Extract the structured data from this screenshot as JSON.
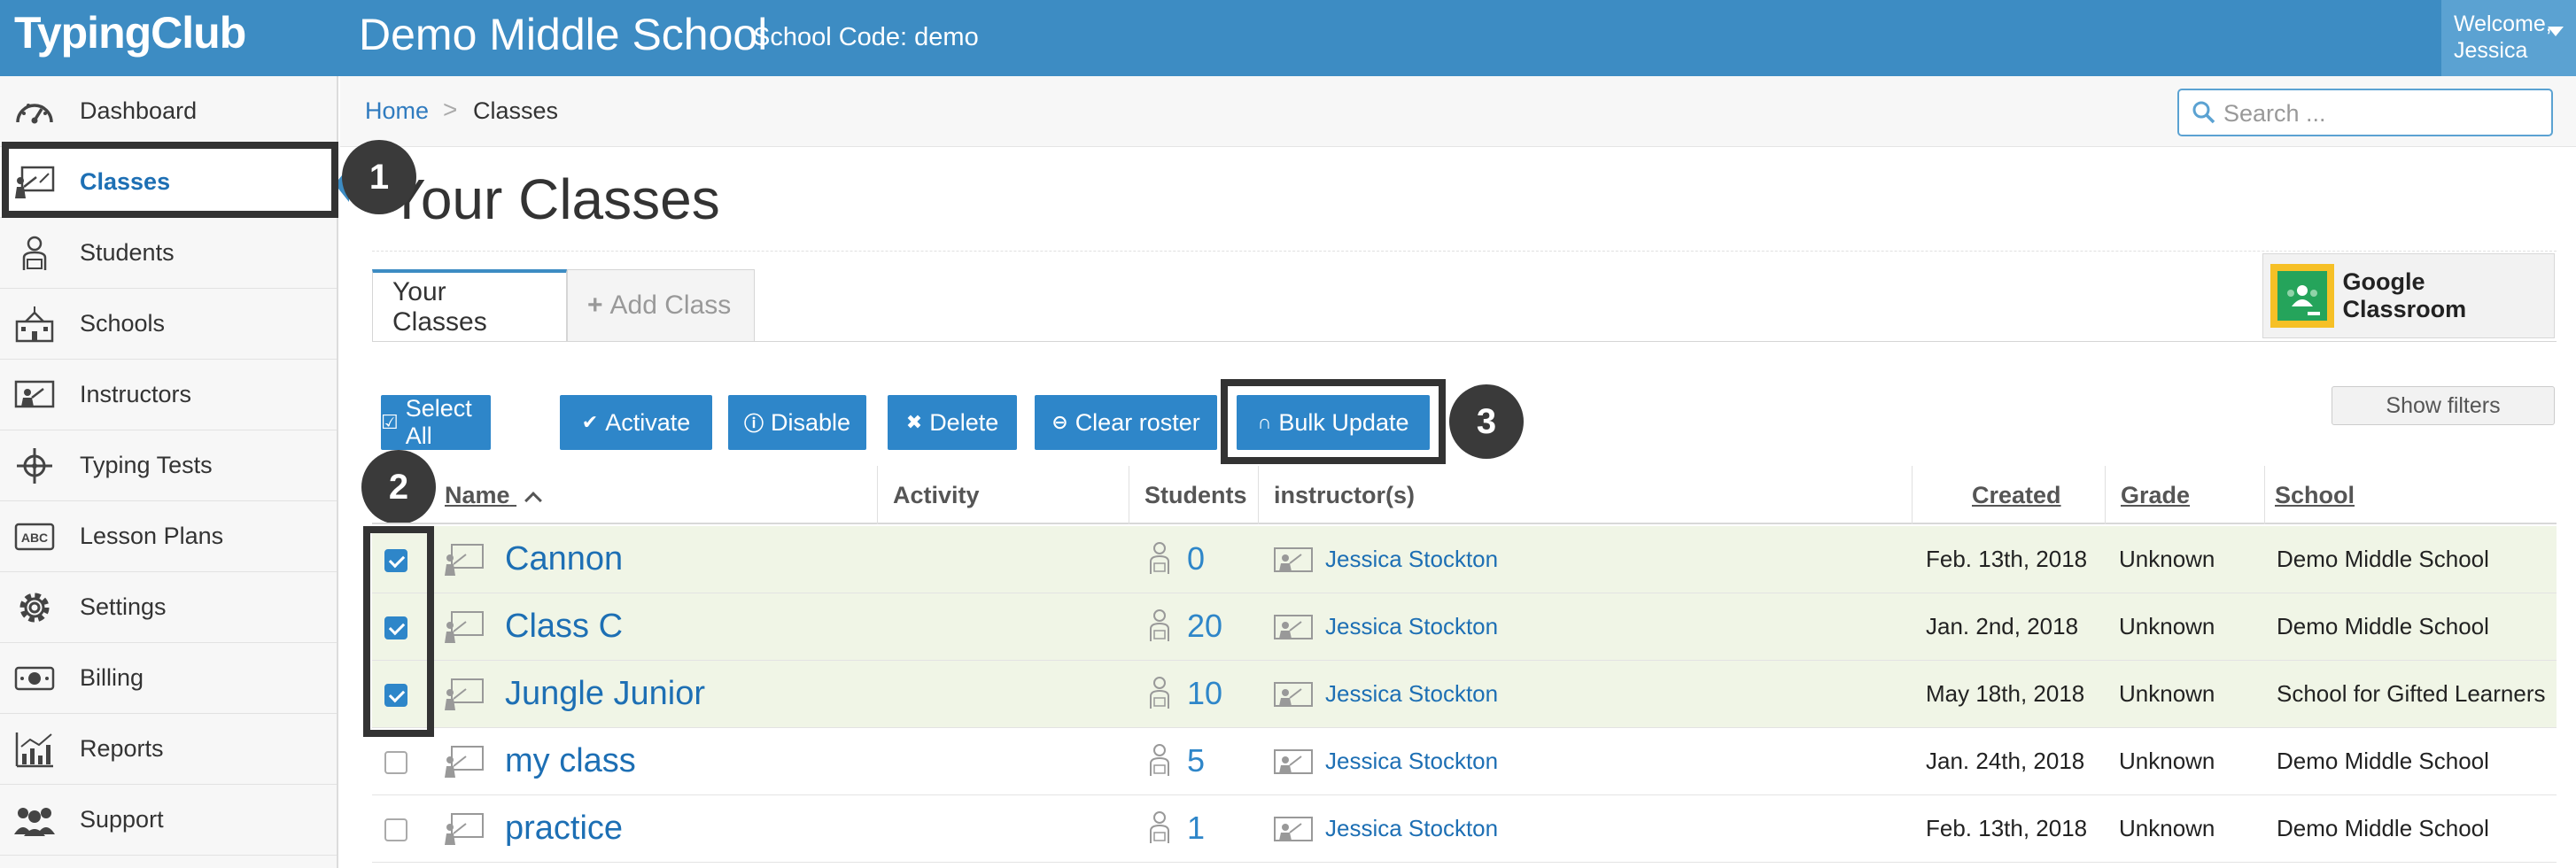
{
  "app": {
    "brand": "TypingClub",
    "school_name": "Demo Middle School",
    "school_code": "School Code: demo",
    "welcome_line1": "Welcome,",
    "welcome_line2": "Jessica"
  },
  "sidebar": {
    "items": [
      {
        "label": "Dashboard",
        "icon": "dashboard-gauge-icon"
      },
      {
        "label": "Classes",
        "icon": "classroom-icon",
        "active": true
      },
      {
        "label": "Students",
        "icon": "student-icon"
      },
      {
        "label": "Schools",
        "icon": "school-building-icon"
      },
      {
        "label": "Instructors",
        "icon": "instructor-icon"
      },
      {
        "label": "Typing Tests",
        "icon": "typing-test-icon"
      },
      {
        "label": "Lesson Plans",
        "icon": "abc-icon"
      },
      {
        "label": "Settings",
        "icon": "gear-icon"
      },
      {
        "label": "Billing",
        "icon": "money-icon"
      },
      {
        "label": "Reports",
        "icon": "reports-chart-icon"
      },
      {
        "label": "Support",
        "icon": "support-people-icon"
      }
    ]
  },
  "breadcrumb": {
    "home": "Home",
    "separator": ">",
    "current": "Classes"
  },
  "search": {
    "placeholder": "Search ...",
    "value": ""
  },
  "page": {
    "title": "Your Classes"
  },
  "tabs": {
    "your_classes": "Your Classes",
    "add_class": "Add Class",
    "add_glyph": "+"
  },
  "google_classroom": {
    "label": "Google Classroom"
  },
  "toolbar": {
    "select_all": "Select All",
    "activate": "Activate",
    "disable": "Disable",
    "delete": "Delete",
    "clear_roster": "Clear roster",
    "bulk_update": "Bulk Update",
    "show_filters": "Show filters"
  },
  "callouts": [
    "1",
    "2",
    "3"
  ],
  "table": {
    "headers": {
      "name": "Name",
      "activity": "Activity",
      "students": "Students",
      "instructors": "instructor(s)",
      "created": "Created",
      "grade": "Grade",
      "school": "School"
    },
    "rows": [
      {
        "checked": true,
        "name": "Cannon",
        "students": "0",
        "instructor": "Jessica Stockton",
        "created": "Feb. 13th, 2018",
        "grade": "Unknown",
        "school": "Demo Middle School"
      },
      {
        "checked": true,
        "name": "Class C",
        "students": "20",
        "instructor": "Jessica Stockton",
        "created": "Jan. 2nd, 2018",
        "grade": "Unknown",
        "school": "Demo Middle School"
      },
      {
        "checked": true,
        "name": "Jungle Junior",
        "students": "10",
        "instructor": "Jessica Stockton",
        "created": "May 18th, 2018",
        "grade": "Unknown",
        "school": "School for Gifted Learners"
      },
      {
        "checked": false,
        "name": "my class",
        "students": "5",
        "instructor": "Jessica Stockton",
        "created": "Jan. 24th, 2018",
        "grade": "Unknown",
        "school": "Demo Middle School"
      },
      {
        "checked": false,
        "name": "practice",
        "students": "1",
        "instructor": "Jessica Stockton",
        "created": "Feb. 13th, 2018",
        "grade": "Unknown",
        "school": "Demo Middle School"
      }
    ]
  },
  "colors": {
    "topbar": "#3d8cc3",
    "button": "#2e86c9",
    "link": "#1d6fb4",
    "selected_row": "#f0f5e6",
    "callout": "#3a3a3a"
  }
}
